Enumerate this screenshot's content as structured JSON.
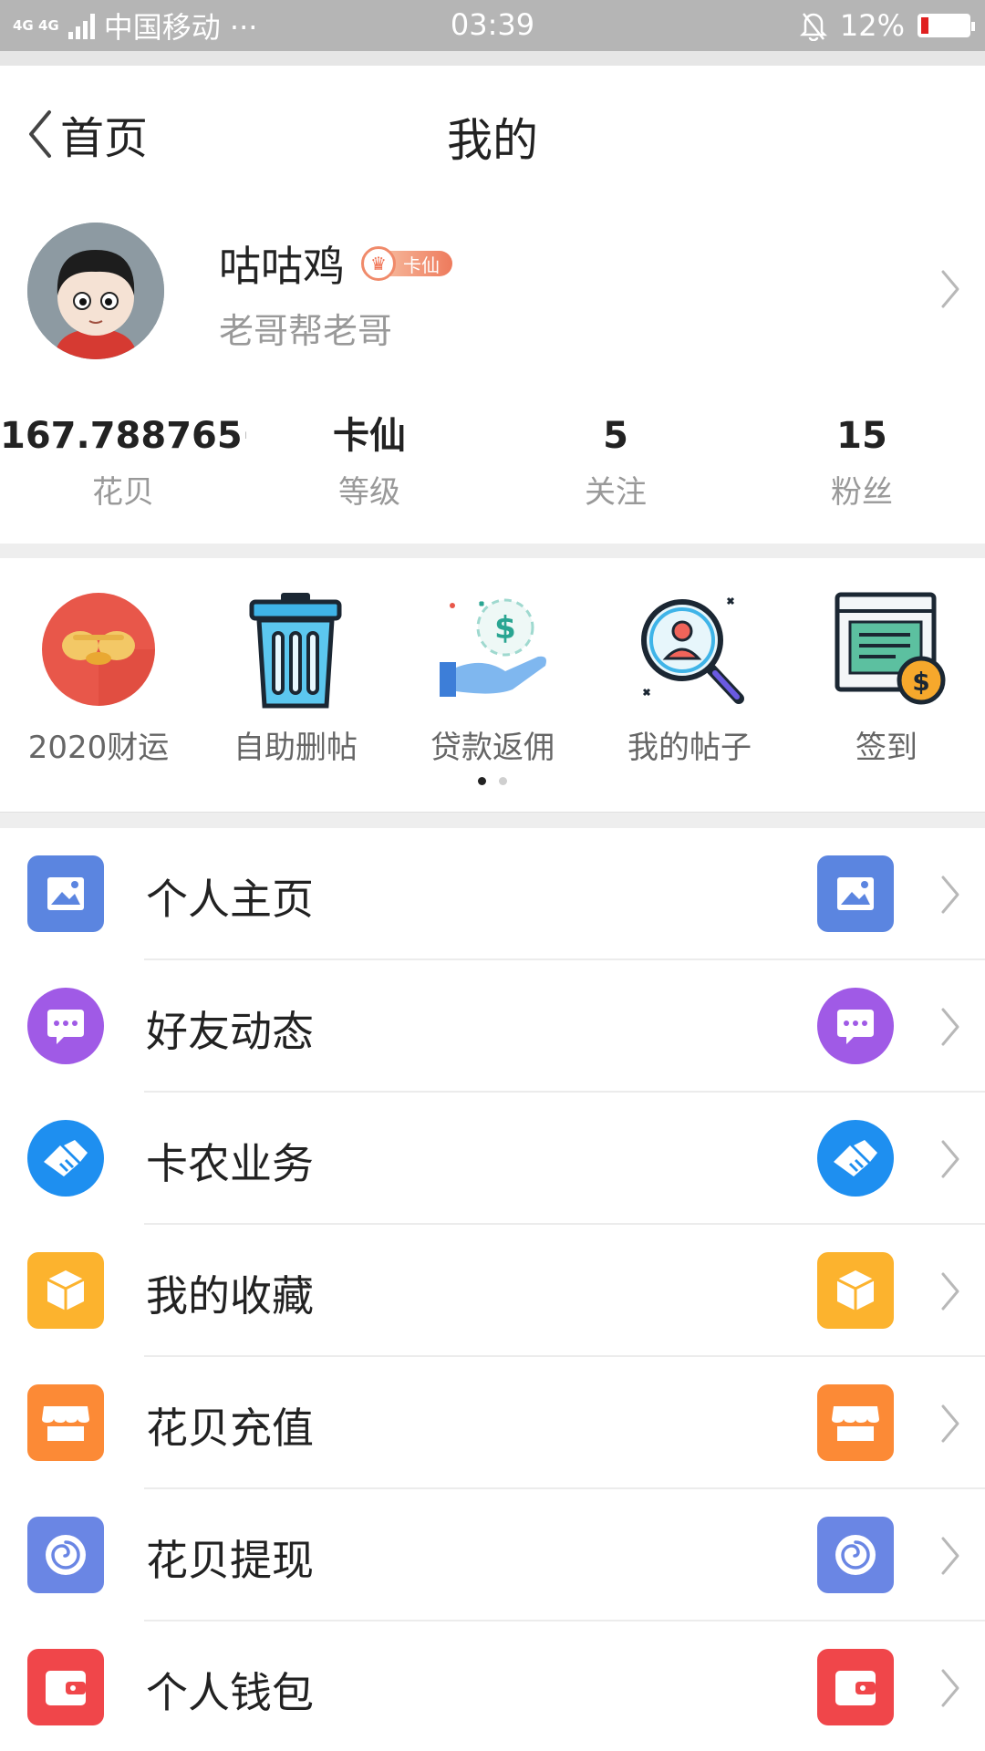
{
  "status_bar": {
    "network": "4G 4G",
    "carrier": "中国移动 ···",
    "time": "03:39",
    "battery": "12%"
  },
  "header": {
    "back_label": "首页",
    "title": "我的"
  },
  "profile": {
    "name": "咕咕鸡",
    "badge": "卡仙",
    "subtitle": "老哥帮老哥"
  },
  "stats": [
    {
      "value": "167.788765···",
      "label": "花贝"
    },
    {
      "value": "卡仙",
      "label": "等级"
    },
    {
      "value": "5",
      "label": "关注"
    },
    {
      "value": "15",
      "label": "粉丝"
    }
  ],
  "quick": [
    {
      "label": "2020财运",
      "icon": "fortune-icon"
    },
    {
      "label": "自助删帖",
      "icon": "trash-icon"
    },
    {
      "label": "贷款返佣",
      "icon": "loan-hand-icon"
    },
    {
      "label": "我的帖子",
      "icon": "search-user-icon"
    },
    {
      "label": "签到",
      "icon": "checkin-icon"
    }
  ],
  "pager": {
    "pages": 2,
    "active": 1
  },
  "menu": [
    {
      "label": "个人主页",
      "icon": "image-icon",
      "color": "#5b85e0"
    },
    {
      "label": "好友动态",
      "icon": "message-icon",
      "color": "#a05ae6"
    },
    {
      "label": "卡农业务",
      "icon": "handshake-icon",
      "color": "#1e8ff0"
    },
    {
      "label": "我的收藏",
      "icon": "box-icon",
      "color": "#fcb32e"
    },
    {
      "label": "花贝充值",
      "icon": "store-icon",
      "color": "#fc8a36"
    },
    {
      "label": "花贝提现",
      "icon": "swirl-icon",
      "color": "#6a86e4"
    },
    {
      "label": "个人钱包",
      "icon": "wallet-icon",
      "color": "#f0464a"
    }
  ]
}
